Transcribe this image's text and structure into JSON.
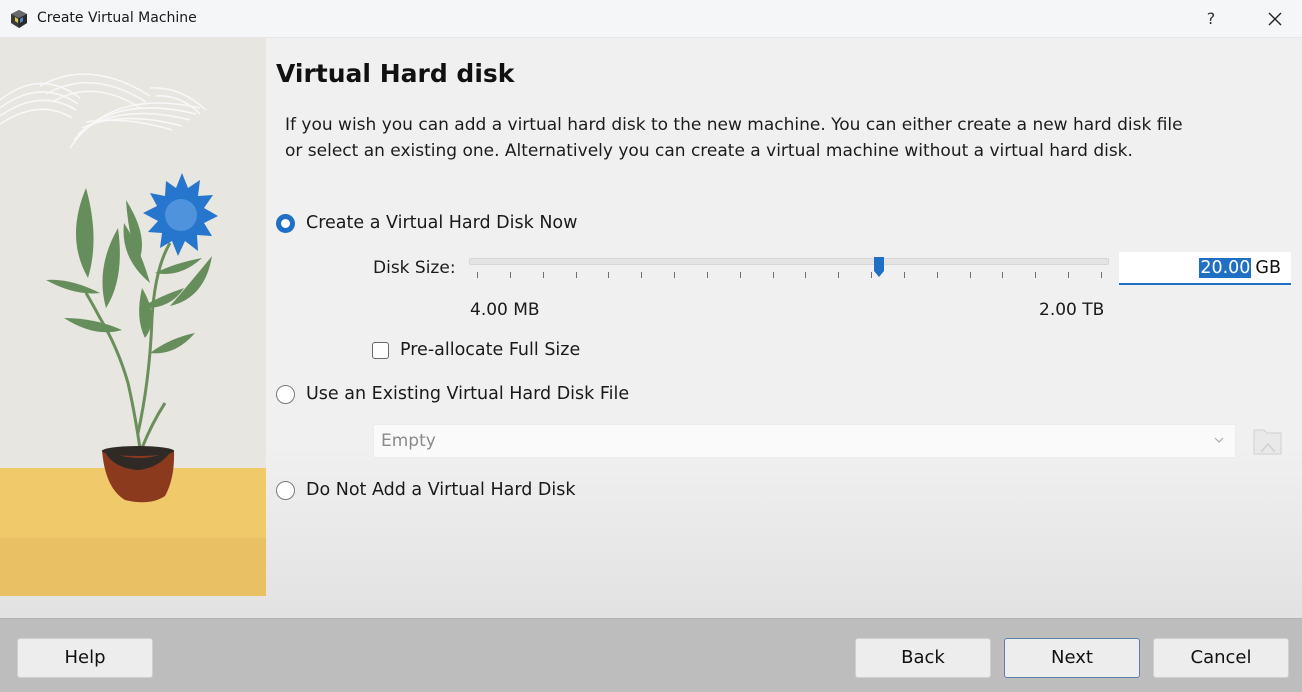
{
  "window": {
    "title": "Create Virtual Machine",
    "app_icon": "virtualbox-cube-icon",
    "help_label": "?",
    "close_icon": "close-icon"
  },
  "page": {
    "title": "Virtual Hard disk",
    "description": "If you wish you can add a virtual hard disk to the new machine. You can either create a new hard disk file or select an existing one. Alternatively you can create a virtual machine without a virtual hard disk."
  },
  "options": {
    "create_now": {
      "label": "Create a Virtual Hard Disk Now",
      "selected": true
    },
    "use_existing": {
      "label": "Use an Existing Virtual Hard Disk File",
      "selected": false
    },
    "do_not_add": {
      "label": "Do Not Add a Virtual Hard Disk",
      "selected": false
    }
  },
  "disk_size": {
    "label": "Disk Size:",
    "min_label": "4.00 MB",
    "max_label": "2.00 TB",
    "value": "20.00",
    "unit": "GB",
    "slider_fraction": 0.645,
    "tick_count": 20,
    "accent_color": "#1f6fc5"
  },
  "preallocate": {
    "label": "Pre-allocate Full Size",
    "checked": false
  },
  "existing_disk": {
    "selected": "Empty",
    "chevron_icon": "chevron-down-icon",
    "browse_icon": "folder-browse-icon"
  },
  "footer": {
    "help": "Help",
    "back": "Back",
    "next": "Next",
    "cancel": "Cancel"
  }
}
